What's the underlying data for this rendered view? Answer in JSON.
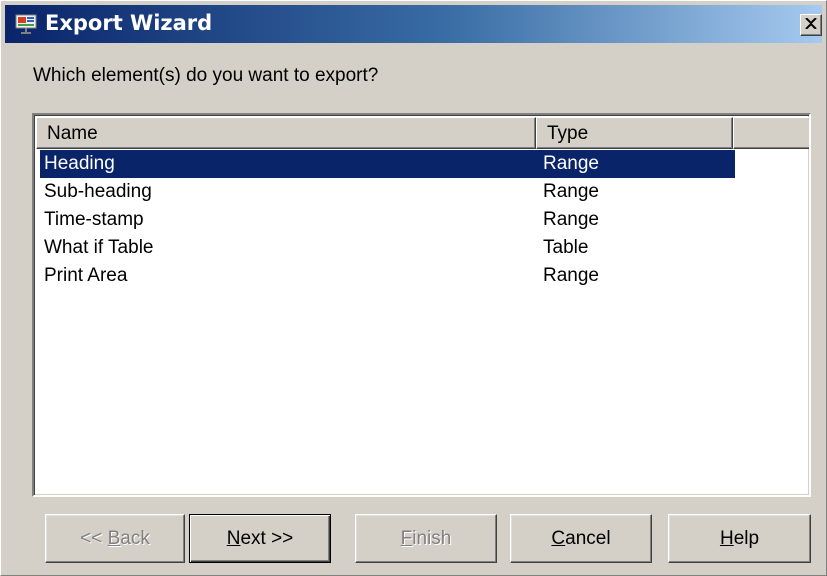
{
  "window": {
    "title": "Export Wizard",
    "close_glyph": "×",
    "icon": "export-wizard-app-icon"
  },
  "prompt": "Which element(s) do you want to export?",
  "list": {
    "columns": [
      "Name",
      "Type",
      ""
    ],
    "rows": [
      {
        "name": "Heading",
        "type": "Range",
        "selected": true
      },
      {
        "name": "Sub-heading",
        "type": "Range",
        "selected": false
      },
      {
        "name": "Time-stamp",
        "type": "Range",
        "selected": false
      },
      {
        "name": "What if Table",
        "type": "Table",
        "selected": false
      },
      {
        "name": "Print Area",
        "type": "Range",
        "selected": false
      }
    ]
  },
  "buttons": {
    "back": {
      "pre": "<< ",
      "accel": "B",
      "post": "ack",
      "enabled": false
    },
    "next": {
      "pre": "",
      "accel": "N",
      "post": "ext >>",
      "enabled": true
    },
    "finish": {
      "pre": "",
      "accel": "F",
      "post": "inish",
      "enabled": false
    },
    "cancel": {
      "pre": "",
      "accel": "C",
      "post": "ancel",
      "enabled": true
    },
    "help": {
      "pre": "",
      "accel": "H",
      "post": "elp",
      "enabled": true
    }
  },
  "colors": {
    "face": "#d4d0c8",
    "title_start": "#0a246a",
    "title_end": "#a6caf0",
    "selection": "#0a246a",
    "disabled_text": "#808080"
  }
}
